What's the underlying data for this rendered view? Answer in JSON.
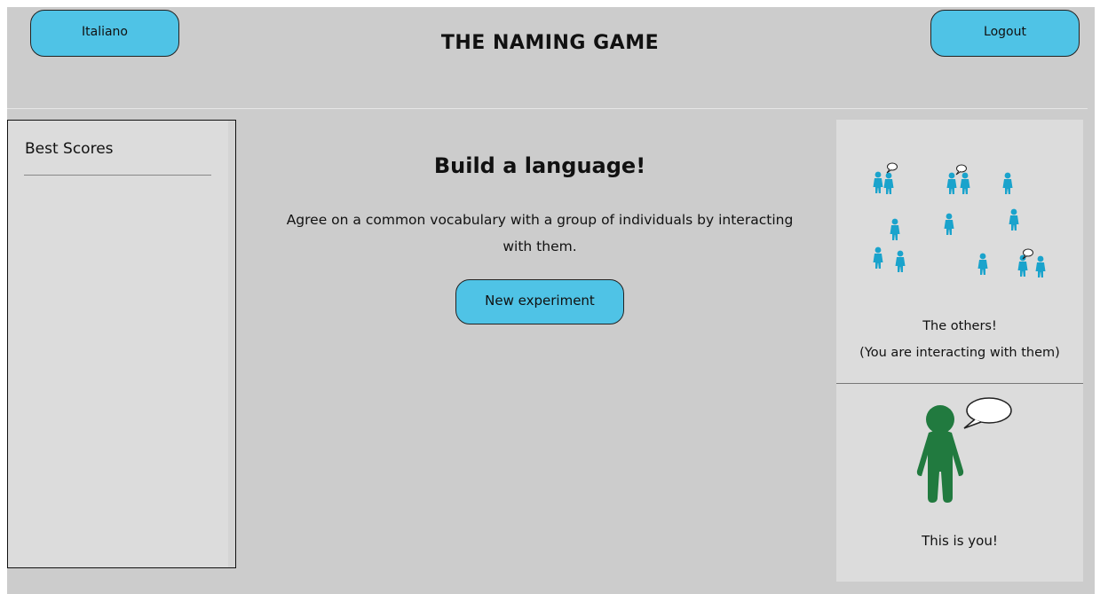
{
  "header": {
    "language_button": "Italiano",
    "title": "THE NAMING GAME",
    "logout_button": "Logout"
  },
  "scores": {
    "title": "Best Scores"
  },
  "main": {
    "heading": "Build a language!",
    "description": "Agree on a common vocabulary with a group of individuals by interacting with them.",
    "new_experiment_button": "New experiment"
  },
  "others": {
    "label_line1": "The others!",
    "label_line2": "(You are interacting with them)"
  },
  "you": {
    "label": "This is you!"
  },
  "colors": {
    "background": "#cccccc",
    "panel": "#dcdcdc",
    "button": "#4fc3e6",
    "others_figure": "#1aa3cc",
    "you_figure": "#217a3f"
  }
}
